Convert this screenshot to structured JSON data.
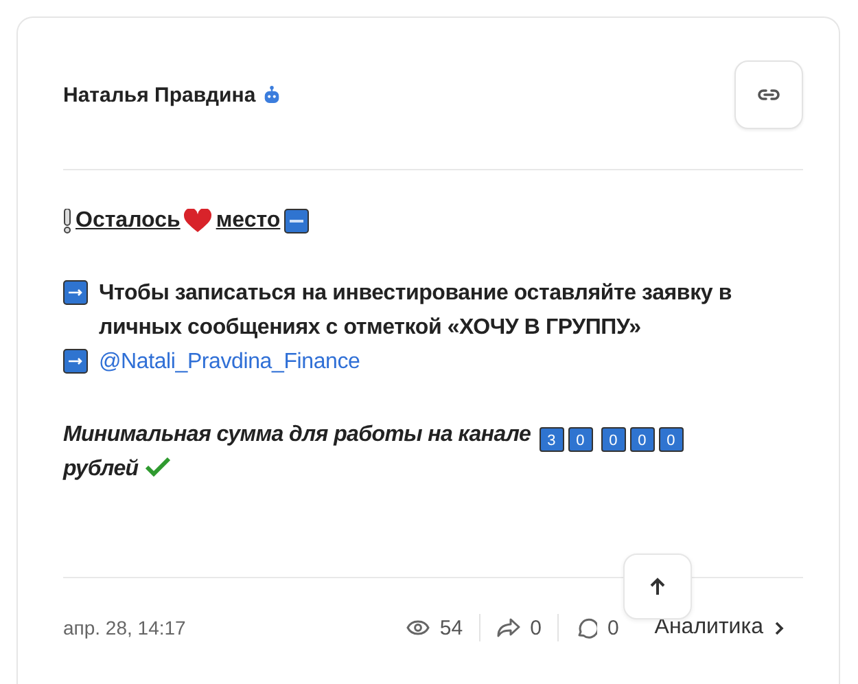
{
  "author": {
    "name": "Наталья Правдина"
  },
  "headline": {
    "parts": [
      "Осталось",
      "место"
    ]
  },
  "lines": [
    {
      "kind": "text",
      "text": "Чтобы записаться на инвестирование оставляйте заявку в личных сообщениях с отметкой «ХОЧУ В ГРУППУ»"
    },
    {
      "kind": "link",
      "text": "@Natali_Pravdina_Finance"
    }
  ],
  "note": {
    "text": "Минимальная сумма для работы на канале",
    "groups": [
      [
        "3",
        "0"
      ],
      [
        "0",
        "0",
        "0"
      ]
    ],
    "tail": "рублей"
  },
  "footer": {
    "date": "апр. 28, 14:17",
    "views": "54",
    "shares": "0",
    "comments": "0",
    "analytics": "Аналитика"
  }
}
